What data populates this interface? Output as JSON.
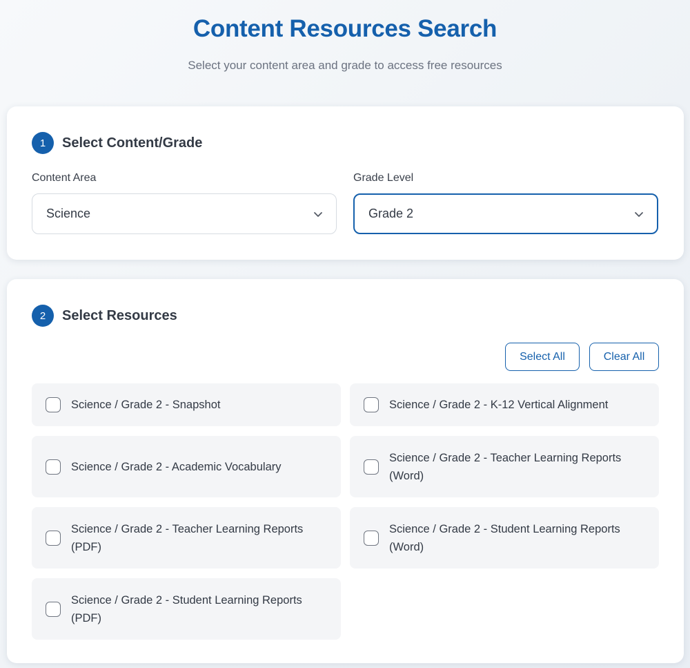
{
  "header": {
    "title": "Content Resources Search",
    "subtitle": "Select your content area and grade to access free resources"
  },
  "step1": {
    "number": "1",
    "title": "Select Content/Grade",
    "content_area": {
      "label": "Content Area",
      "value": "Science"
    },
    "grade_level": {
      "label": "Grade Level",
      "value": "Grade 2"
    }
  },
  "step2": {
    "number": "2",
    "title": "Select Resources",
    "select_all_label": "Select All",
    "clear_all_label": "Clear All",
    "resources": [
      {
        "label": "Science / Grade 2 - Snapshot",
        "checked": false
      },
      {
        "label": "Science / Grade 2 - K-12 Vertical Alignment",
        "checked": false
      },
      {
        "label": "Science / Grade 2 - Academic Vocabulary",
        "checked": false
      },
      {
        "label": "Science / Grade 2 - Teacher Learning Reports (Word)",
        "checked": false
      },
      {
        "label": "Science / Grade 2 - Teacher Learning Reports (PDF)",
        "checked": false
      },
      {
        "label": "Science / Grade 2 - Student Learning Reports (Word)",
        "checked": false
      },
      {
        "label": "Science / Grade 2 - Student Learning Reports (PDF)",
        "checked": false
      }
    ]
  },
  "colors": {
    "accent": "#1560ac",
    "item_background": "#f4f5f7"
  },
  "icons": {
    "dropdown": "chevron-down-icon",
    "checkbox": "checkbox-unchecked-icon"
  }
}
